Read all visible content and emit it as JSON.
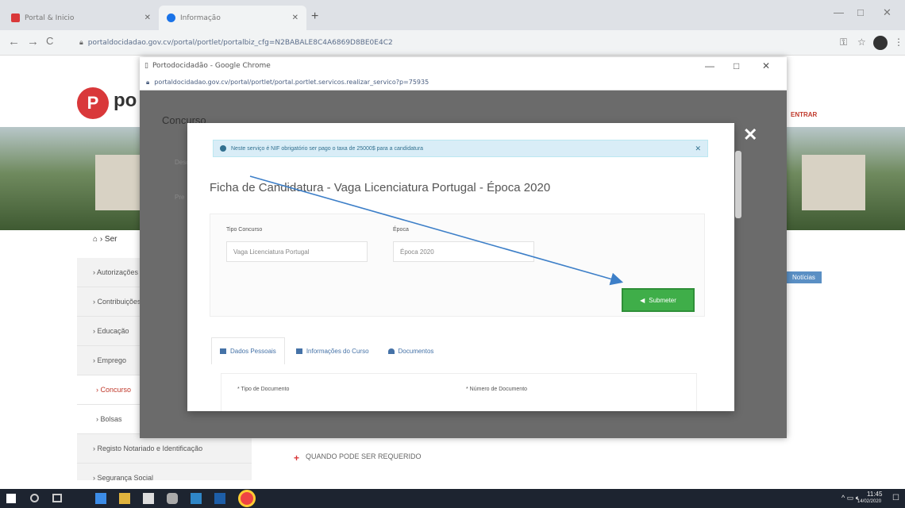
{
  "browser": {
    "tabs": [
      {
        "label": "Portal & Inicio",
        "color": "#d9383a"
      },
      {
        "label": "Informação",
        "color": "#1a73e8"
      }
    ],
    "new_tab": "+",
    "address": "portaldocidadao.gov.cv/portal/portlet/portalbiz_cfg=N2BABALE8C4A6869D8BE0E4C2",
    "nav": {
      "back": "←",
      "forward": "→",
      "reload": "C"
    },
    "window_controls": {
      "min": "—",
      "max": "□",
      "close": "✕"
    }
  },
  "page": {
    "logo_letter": "P",
    "logo_text": "po",
    "nav_right": "ENTRAR",
    "breadcrumb": "⌂ › Ser",
    "sidebar": [
      {
        "label": "› Autorizações",
        "sub": false,
        "active": false
      },
      {
        "label": "› Contribuições",
        "sub": false,
        "active": false
      },
      {
        "label": "› Educação",
        "sub": false,
        "active": false
      },
      {
        "label": "› Emprego",
        "sub": false,
        "active": false
      },
      {
        "label": "› Concurso",
        "sub": true,
        "active": true
      },
      {
        "label": "› Bolsas",
        "sub": true,
        "active": false
      },
      {
        "label": "› Registo Notariado e Identificação",
        "sub": false,
        "active": false
      },
      {
        "label": "› Segurança Social",
        "sub": false,
        "active": false
      }
    ],
    "badge": "Notícias",
    "content_item": "QUANDO PODE SER REQUERIDO"
  },
  "popup": {
    "title": "Portodocidadão - Google Chrome",
    "url": "portaldocidadao.gov.cv/portal/portlet/portal.portlet.servicos.realizar_servico?p=75935",
    "heading": "Concurso",
    "labels": [
      "Desc",
      "Pre"
    ]
  },
  "modal": {
    "alert": "Neste serviço é NIF obrigatório ser pago o taxa de 25000$ para a candidatura",
    "title": "Ficha de Candidatura - Vaga Licenciatura Portugal - Época 2020",
    "field1_label": "Tipo Concurso",
    "field1_value": "Vaga Licenciatura Portugal",
    "field2_label": "Época",
    "field2_value": "Época 2020",
    "submit": "Submeter",
    "tabs": [
      "Dados Pessoais",
      "Informações do Curso",
      "Documentos"
    ],
    "panel_label1": "* Tipo de Documento",
    "panel_label2": "* Número de Documento",
    "close": "✕"
  },
  "taskbar": {
    "time": "11:45",
    "date": "14/02/2020"
  }
}
